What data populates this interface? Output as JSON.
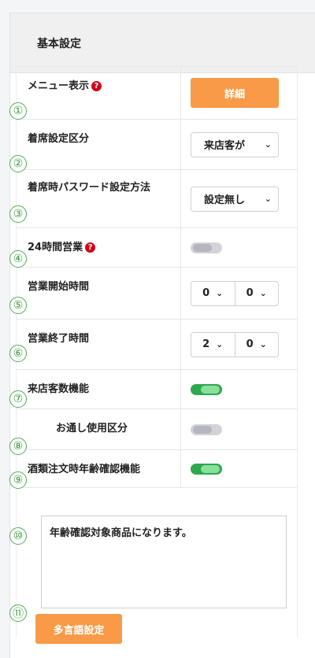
{
  "card": {
    "title": "基本設定"
  },
  "markers": [
    "①",
    "②",
    "③",
    "④",
    "⑤",
    "⑥",
    "⑦",
    "⑧",
    "⑨",
    "⑩",
    "⑪"
  ],
  "rows": {
    "menu_display": {
      "label": "メニュー表示",
      "button": "詳細",
      "help_icon": "question-circle-icon"
    },
    "seating_category": {
      "label": "着席設定区分",
      "value": "来店客が"
    },
    "seat_password": {
      "label": "着席時パスワード設定方法",
      "value": "設定無し"
    },
    "open_24h": {
      "label": "24時間営業",
      "help_icon": "question-circle-icon",
      "enabled": false
    },
    "open_time": {
      "label": "営業開始時間",
      "hour": "0",
      "minute": "0"
    },
    "close_time": {
      "label": "営業終了時間",
      "hour": "2",
      "minute": "0"
    },
    "guest_count": {
      "label": "来店客数機能",
      "enabled": true
    },
    "otoshi": {
      "label": "お通し使用区分",
      "enabled": false
    },
    "alcohol_age_check": {
      "label": "酒類注文時年齢確認機能",
      "enabled": true
    }
  },
  "age_message": "年齢確認対象商品になります。",
  "multilang_button": "多言語設定",
  "colors": {
    "accent_orange": "#f89a47",
    "toggle_on": "#2ea84c",
    "marker_green": "#4caf50",
    "help_red": "#d0021b"
  }
}
